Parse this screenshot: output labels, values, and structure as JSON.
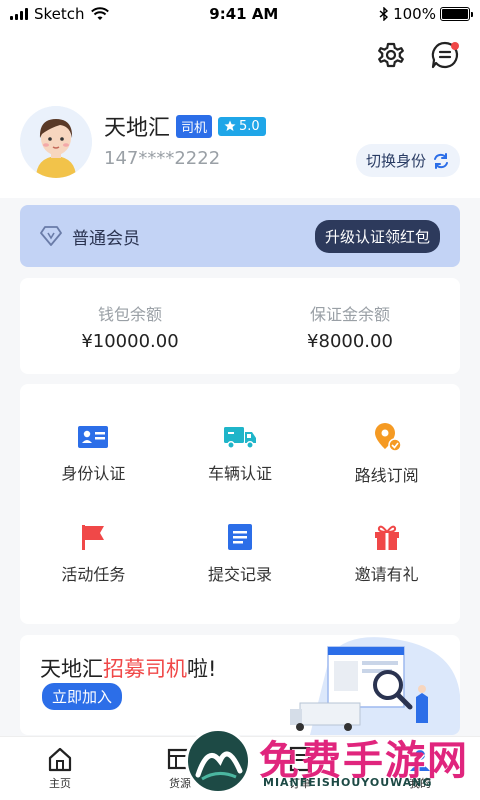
{
  "status_bar": {
    "carrier": "Sketch",
    "time": "9:41 AM",
    "battery": "100%"
  },
  "profile": {
    "name": "天地汇",
    "role": "司机",
    "rating": "5.0",
    "phone": "147****2222",
    "switch_label": "切换身份"
  },
  "member": {
    "level": "普通会员",
    "upgrade_label": "升级认证领红包"
  },
  "wallet": {
    "balance_label": "钱包余额",
    "balance_value": "¥10000.00",
    "deposit_label": "保证金余额",
    "deposit_value": "¥8000.00"
  },
  "menu": {
    "items": [
      {
        "label": "身份认证",
        "icon": "id-card-icon",
        "color": "#2c6ee8"
      },
      {
        "label": "车辆认证",
        "icon": "truck-icon",
        "color": "#1fb5c9"
      },
      {
        "label": "路线订阅",
        "icon": "location-pin-icon",
        "color": "#f59a23"
      },
      {
        "label": "活动任务",
        "icon": "flag-icon",
        "color": "#f04848"
      },
      {
        "label": "提交记录",
        "icon": "document-icon",
        "color": "#2c6ee8"
      },
      {
        "label": "邀请有礼",
        "icon": "gift-icon",
        "color": "#f04848"
      }
    ]
  },
  "banner": {
    "title_prefix": "天地汇",
    "title_highlight": "招募司机",
    "title_suffix": "啦!",
    "button_label": "立即加入"
  },
  "tabbar": {
    "tabs": [
      {
        "label": "主页",
        "icon": "home-icon"
      },
      {
        "label": "货源",
        "icon": "cargo-icon"
      },
      {
        "label": "订单",
        "icon": "order-icon"
      },
      {
        "label": "我的",
        "icon": "profile-icon"
      }
    ]
  },
  "watermark": {
    "text": "免费手游网",
    "subtext": "MIANFEISHOUYOUWANG"
  },
  "colors": {
    "accent": "#2c6ee8",
    "member_bg": "#c3d3f5",
    "highlight": "#f04848"
  }
}
